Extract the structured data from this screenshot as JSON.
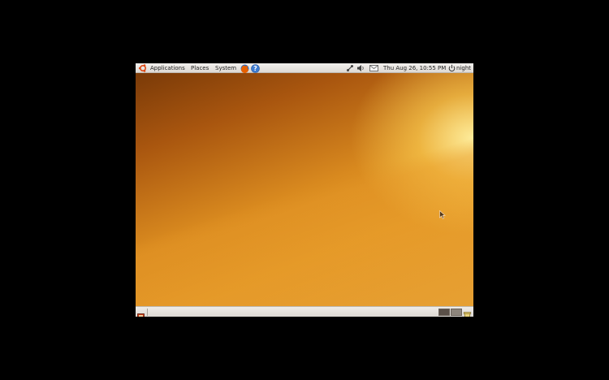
{
  "top_panel": {
    "menus": {
      "applications": "Applications",
      "places": "Places",
      "system": "System"
    },
    "icons": [
      "ubuntu-logo-icon",
      "firefox-icon",
      "help-icon",
      "network-icon",
      "volume-icon",
      "mail-icon",
      "power-icon"
    ],
    "clock": "Thu Aug 26, 10:55 PM",
    "user": "night"
  },
  "bottom_panel": {
    "icons": [
      "show-desktop-icon",
      "trash-icon"
    ],
    "workspaces": 2
  },
  "colors": {
    "panel": "#e6e2dd",
    "wallpaper_dark": "#7a3a08",
    "wallpaper_light": "#f5dc7a"
  }
}
